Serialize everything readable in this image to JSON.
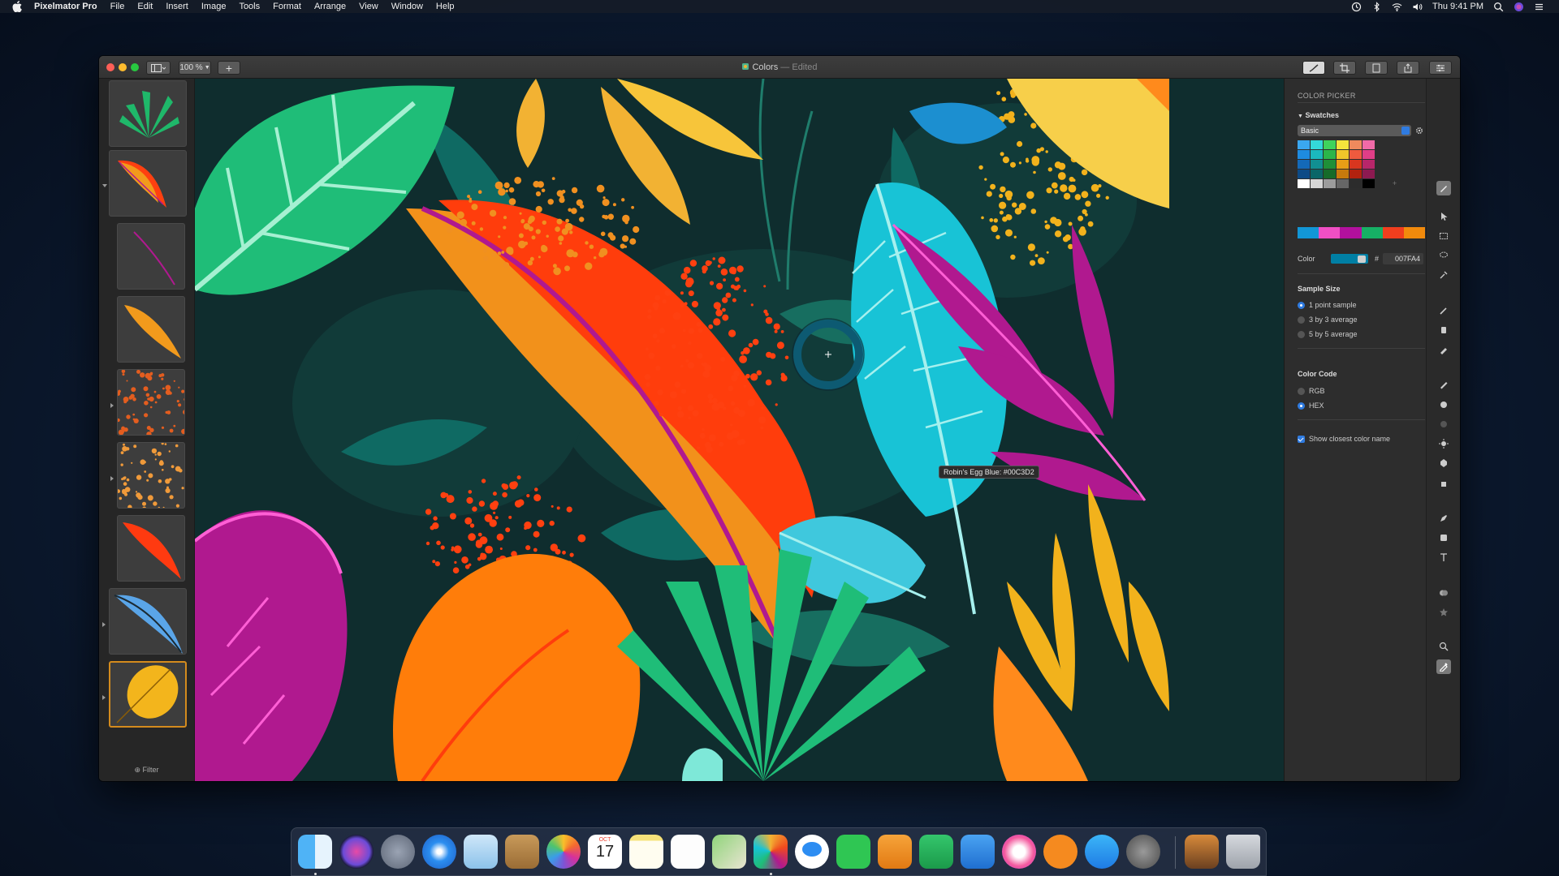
{
  "menubar": {
    "app_name": "Pixelmator Pro",
    "menus": [
      "File",
      "Edit",
      "Insert",
      "Image",
      "Tools",
      "Format",
      "Arrange",
      "View",
      "Window",
      "Help"
    ],
    "clock": "Thu 9:41 PM",
    "status_icons": [
      "time-machine-icon",
      "bluetooth-icon",
      "wifi-icon",
      "volume-icon",
      "spotlight-icon",
      "siri-icon",
      "menu-extra-icon"
    ]
  },
  "window": {
    "doc_title": "Colors",
    "doc_status": "— Edited",
    "zoom": "100 %",
    "add_label": "+",
    "toolbar_right": [
      "style-icon",
      "crop-icon",
      "arrange-icon",
      "share-icon",
      "tools-icon"
    ]
  },
  "layers": {
    "filter_label": "Filter"
  },
  "canvas": {
    "picker_tooltip": "Robin's Egg Blue: #00C3D2"
  },
  "inspector": {
    "title": "COLOR PICKER",
    "swatches_label": "Swatches",
    "swatch_set": "Basic",
    "swatch_colors": [
      [
        "#3aa7f0",
        "#34d9d9",
        "#3fd35c",
        "#f5e33c",
        "#f08a5d",
        "#f06aa8"
      ],
      [
        "#1e8be0",
        "#1bb9bd",
        "#2bb54a",
        "#f0c52a",
        "#ee5a3e",
        "#e03e87"
      ],
      [
        "#1469b8",
        "#118f92",
        "#1f8f38",
        "#e89e16",
        "#d8361f",
        "#b8266a"
      ],
      [
        "#0d4a86",
        "#0b6668",
        "#166b29",
        "#c77a0d",
        "#b2220f",
        "#8d1a51"
      ],
      [
        "#ffffff",
        "#d6d6d6",
        "#9c9c9c",
        "#666666",
        "#2c2c2c",
        "#000000"
      ]
    ],
    "recent_colors": [
      "#1296d6",
      "#f04fc4",
      "#b2109d",
      "#16b065",
      "#f03e1e",
      "#f18a0c"
    ],
    "color_label": "Color",
    "color_value": "#007fa4",
    "hex_prefix": "#",
    "hex_value": "007FA4",
    "sample_size_label": "Sample Size",
    "sample_options": [
      "1 point sample",
      "3 by 3 average",
      "5 by 5 average"
    ],
    "sample_selected": 0,
    "color_code_label": "Color Code",
    "code_options": [
      "RGB",
      "HEX"
    ],
    "code_selected": 1,
    "closest_label": "Show closest color name",
    "closest_checked": true
  },
  "tools": [
    "style-tool-icon",
    "select-arrow-icon",
    "rect-select-icon",
    "lasso-icon",
    "quick-select-icon",
    "paint-icon",
    "erase-icon",
    "retouch-icon",
    "ruler-icon",
    "clone-icon",
    "burn-icon",
    "sponge-icon",
    "light-icon",
    "shape-icon",
    "hand-icon",
    "pen-icon",
    "rectangle-icon",
    "type-icon",
    "color-adjust-icon",
    "effects-icon",
    "zoom-icon",
    "color-picker-icon"
  ],
  "dock": {
    "apps": [
      "finder-icon",
      "siri-icon",
      "launchpad-icon",
      "safari-icon",
      "mail-icon",
      "contacts-icon",
      "photos-icon",
      "calendar-icon",
      "notes-icon",
      "reminders-icon",
      "maps-icon",
      "pixelmator-icon",
      "messages-icon",
      "facetime-icon",
      "pages-icon",
      "numbers-icon",
      "keynote-icon",
      "itunes-icon",
      "books-icon",
      "app-store-icon",
      "system-preferences-icon",
      "downloads-icon",
      "trash-icon"
    ],
    "calendar_month": "OCT",
    "calendar_day": "17"
  }
}
